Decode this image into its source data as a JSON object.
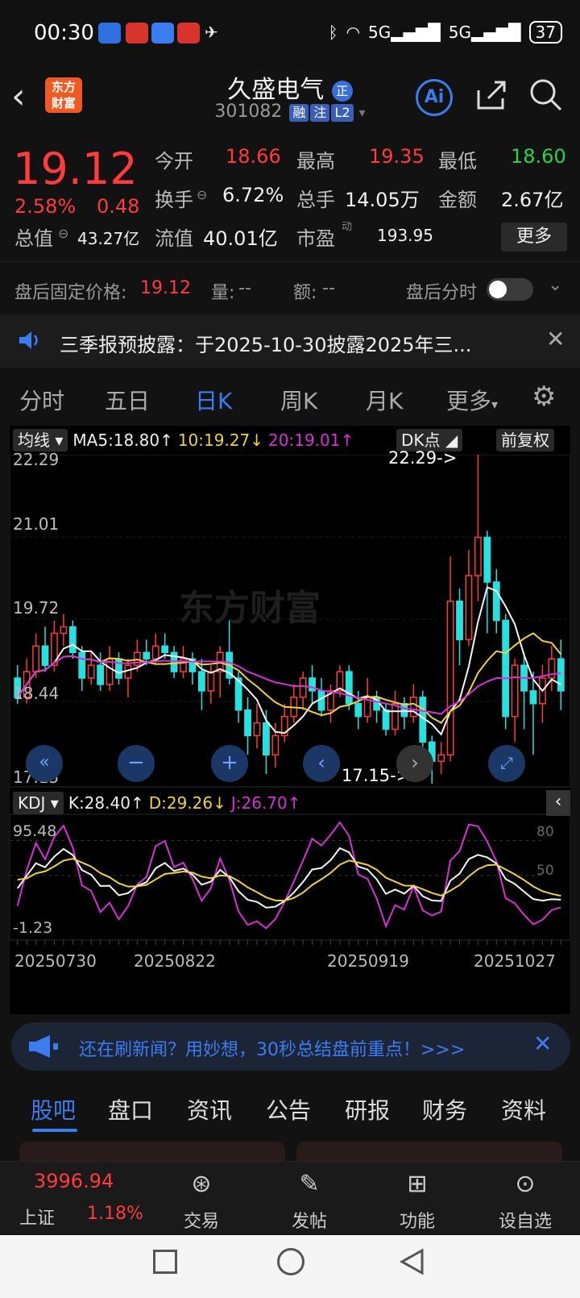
{
  "status": {
    "time": "00:30",
    "battery": "37",
    "net1": "5G",
    "net2": "5G"
  },
  "header": {
    "name": "久盛电气",
    "badge": "正",
    "code": "301082",
    "tags": [
      "融",
      "注",
      "L2"
    ],
    "logo_line1": "东方",
    "logo_line2": "财富",
    "ai_label": "Ai"
  },
  "quote": {
    "price": "19.12",
    "pct": "2.58%",
    "chg": "0.48",
    "open_label": "今开",
    "open": "18.66",
    "high_label": "最高",
    "high": "19.35",
    "low_label": "最低",
    "low": "18.60",
    "turnover_label": "换手",
    "turnover": "6.72%",
    "volume_label": "总手",
    "volume": "14.05万",
    "amount_label": "金额",
    "amount": "2.67亿",
    "mcap_label": "总值",
    "mcap": "43.27亿",
    "float_label": "流值",
    "float": "40.01亿",
    "pe_label": "市盈",
    "pe_sup": "动",
    "pe": "193.95",
    "more": "更多"
  },
  "after": {
    "label": "盘后固定价格:",
    "price": "19.12",
    "vol_label": "量:",
    "vol": "--",
    "amt_label": "额:",
    "amt": "--",
    "toggle_label": "盘后分时"
  },
  "notice": {
    "text": "三季报预披露：于2025-10-30披露2025年三..."
  },
  "tabs": [
    "分时",
    "五日",
    "日K",
    "周K",
    "月K",
    "更多"
  ],
  "chart": {
    "ma_btn": "均线",
    "ma5": "MA5:18.80↑",
    "ma10": "10:19.27↓",
    "ma20": "20:19.01↑",
    "dk": "DK点",
    "fq": "前复权",
    "yticks": [
      "22.29",
      "21.01",
      "19.72",
      "18.44",
      "17.15"
    ],
    "hi_mark": "22.29->",
    "lo_mark": "17.15->",
    "watermark": "东方财富",
    "kdj_btn": "KDJ",
    "k": "K:28.40↑",
    "d": "D:29.26↓",
    "j": "J:26.70↑",
    "kdj_top": "95.48",
    "kdj_bot": "-1.23",
    "kdj_80": "80",
    "kdj_50": "50",
    "dates": [
      "20250730",
      "20250822",
      "20250919",
      "20251027"
    ]
  },
  "chart_data": {
    "type": "candlestick",
    "ylim": [
      17.15,
      22.29
    ],
    "candles": [
      [
        18.8,
        18.5,
        19.0,
        18.4
      ],
      [
        18.5,
        18.9,
        19.1,
        18.4
      ],
      [
        18.9,
        19.3,
        19.5,
        18.8
      ],
      [
        19.3,
        19.0,
        19.6,
        18.9
      ],
      [
        19.0,
        19.5,
        19.7,
        18.9
      ],
      [
        19.5,
        19.6,
        19.8,
        19.3
      ],
      [
        19.6,
        19.2,
        19.7,
        19.1
      ],
      [
        19.2,
        18.8,
        19.3,
        18.6
      ],
      [
        18.8,
        19.0,
        19.2,
        18.7
      ],
      [
        19.0,
        18.7,
        19.2,
        18.6
      ],
      [
        18.7,
        19.1,
        19.3,
        18.6
      ],
      [
        19.1,
        18.8,
        19.2,
        18.7
      ],
      [
        18.8,
        19.0,
        19.1,
        18.5
      ],
      [
        19.0,
        19.2,
        19.4,
        18.9
      ],
      [
        19.2,
        19.1,
        19.4,
        19.0
      ],
      [
        19.1,
        19.3,
        19.5,
        19.0
      ],
      [
        19.3,
        19.2,
        19.5,
        19.1
      ],
      [
        19.2,
        18.9,
        19.3,
        18.8
      ],
      [
        18.9,
        19.1,
        19.3,
        18.8
      ],
      [
        19.1,
        18.9,
        19.2,
        18.7
      ],
      [
        18.9,
        18.6,
        19.1,
        18.3
      ],
      [
        18.6,
        18.9,
        19.0,
        18.4
      ],
      [
        18.9,
        19.2,
        19.3,
        18.5
      ],
      [
        19.2,
        18.8,
        19.7,
        18.7
      ],
      [
        18.8,
        18.3,
        18.9,
        18.1
      ],
      [
        18.3,
        17.9,
        18.5,
        17.6
      ],
      [
        17.9,
        18.1,
        18.4,
        17.7
      ],
      [
        18.1,
        17.6,
        18.3,
        17.3
      ],
      [
        17.6,
        17.9,
        18.1,
        17.4
      ],
      [
        17.9,
        18.2,
        18.4,
        17.8
      ],
      [
        18.2,
        18.5,
        18.7,
        18.1
      ],
      [
        18.5,
        18.8,
        18.9,
        18.3
      ],
      [
        18.8,
        18.6,
        19.0,
        18.4
      ],
      [
        18.6,
        18.3,
        18.8,
        18.2
      ],
      [
        18.3,
        18.6,
        18.7,
        18.1
      ],
      [
        18.6,
        18.9,
        19.0,
        18.5
      ],
      [
        18.9,
        18.4,
        19.0,
        18.3
      ],
      [
        18.4,
        18.2,
        18.6,
        18.0
      ],
      [
        18.2,
        18.5,
        18.8,
        18.1
      ],
      [
        18.5,
        18.3,
        18.6,
        18.1
      ],
      [
        18.3,
        18.0,
        18.4,
        17.9
      ],
      [
        18.0,
        18.4,
        18.6,
        17.9
      ],
      [
        18.4,
        18.2,
        18.5,
        18.0
      ],
      [
        18.2,
        18.5,
        18.7,
        18.1
      ],
      [
        18.5,
        17.8,
        18.6,
        17.6
      ],
      [
        17.8,
        17.5,
        17.9,
        17.15
      ],
      [
        17.5,
        17.6,
        17.8,
        17.3
      ],
      [
        17.6,
        20.0,
        20.7,
        17.5
      ],
      [
        20.0,
        19.4,
        20.2,
        19.0
      ],
      [
        19.4,
        20.4,
        20.8,
        19.3
      ],
      [
        20.4,
        21.0,
        22.29,
        20.0
      ],
      [
        21.0,
        20.3,
        21.1,
        19.5
      ],
      [
        20.3,
        19.7,
        20.5,
        19.5
      ],
      [
        19.7,
        18.2,
        19.8,
        18.0
      ],
      [
        18.2,
        19.0,
        19.1,
        17.8
      ],
      [
        19.0,
        18.6,
        19.2,
        18.0
      ],
      [
        18.6,
        18.4,
        18.9,
        17.6
      ],
      [
        18.4,
        18.8,
        19.0,
        18.1
      ],
      [
        18.8,
        19.1,
        19.3,
        18.6
      ],
      [
        19.1,
        18.6,
        19.4,
        18.3
      ]
    ],
    "kdj_ylim": [
      -1.23,
      95.48
    ]
  },
  "banner": {
    "text": "还在刷新闻？用妙想，30秒总结盘前重点！>>>"
  },
  "news_tabs": [
    "股吧",
    "盘口",
    "资讯",
    "公告",
    "研报",
    "财务",
    "资料"
  ],
  "bottom": {
    "index_value": "3996.94",
    "index_name": "上证",
    "index_pct": "1.18%",
    "items": [
      "交易",
      "发帖",
      "功能",
      "设自选"
    ]
  }
}
